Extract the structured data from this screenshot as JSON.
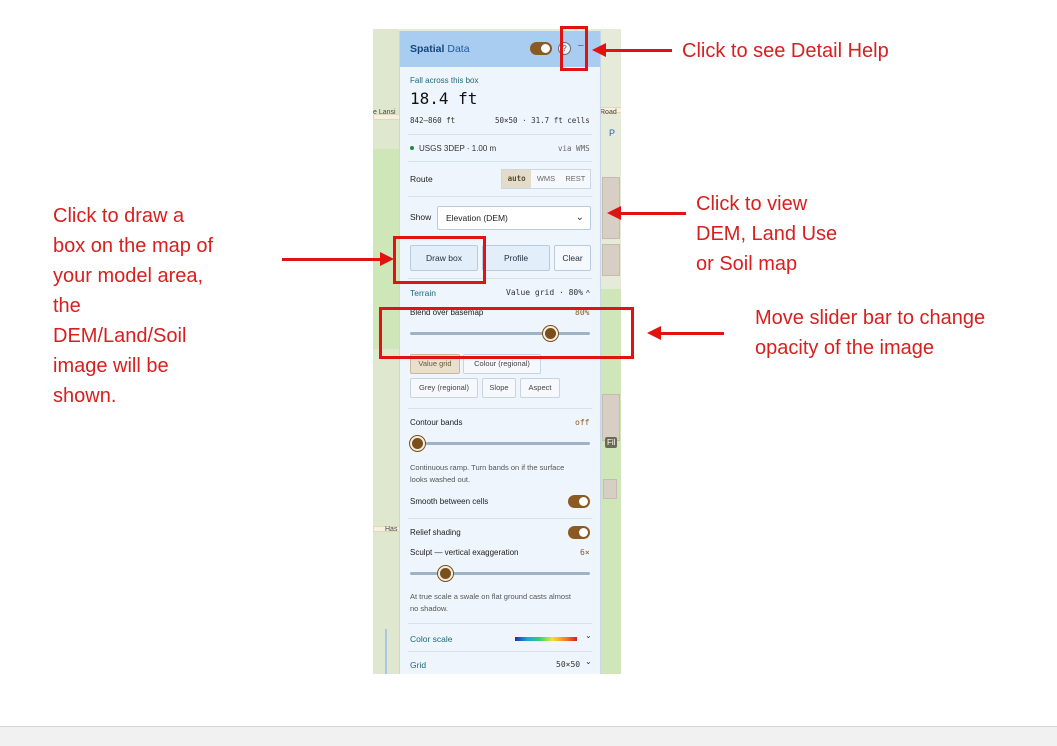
{
  "map": {
    "labels": [
      "e Lansi",
      "Road",
      "Has",
      "P",
      "Fil"
    ]
  },
  "panel": {
    "title_bold": "Spatial",
    "title_rest": "Data",
    "help_glyph": "?",
    "minimize_glyph": "–",
    "fall_label": "Fall across this box",
    "fall_value": "18.4 ft",
    "range": "842–860 ft",
    "grid_info": "50×50 · 31.7 ft cells",
    "source": "USGS 3DEP · 1.00 m",
    "via": "via WMS",
    "route_label": "Route",
    "route_options": [
      "auto",
      "WMS",
      "REST"
    ],
    "show_label": "Show",
    "show_selected": "Elevation (DEM)",
    "buttons": {
      "draw": "Draw box",
      "profile": "Profile",
      "clear": "Clear"
    },
    "terrain_label": "Terrain",
    "terrain_summary": "Value grid · 80%",
    "terrain_chevron": "^",
    "blend_label": "Blend over basemap",
    "blend_value": "80%",
    "blend_level": 0.78,
    "render_modes": [
      "Value grid",
      "Colour (regional)",
      "Grey (regional)",
      "Slope",
      "Aspect"
    ],
    "contour_label": "Contour bands",
    "contour_value": "off",
    "contour_note_1": "Continuous ramp. Turn bands on if the surface",
    "contour_note_2": "looks washed out.",
    "smooth_label": "Smooth between cells",
    "relief_label": "Relief shading",
    "sculpt_label": "Sculpt — vertical exaggeration",
    "sculpt_value": "6×",
    "shadow_note_1": "At true scale a swale on flat ground casts almost",
    "shadow_note_2": "no shadow.",
    "color_scale_label": "Color scale",
    "grid_label": "Grid",
    "grid_value": "50×50",
    "chevron": "⌄"
  },
  "annotations": {
    "help": "Click to see Detail Help",
    "draw": [
      "Click to draw a",
      "box on the map of",
      "your model area,",
      "the",
      "DEM/Land/Soil",
      "image will be",
      "shown."
    ],
    "view": [
      "Click to view",
      "DEM, Land Use",
      "or Soil map"
    ],
    "slider": [
      "Move slider bar to change",
      "opacity of the image"
    ]
  },
  "colors": {
    "accent": "#8a5a22",
    "annotation": "#e01212",
    "header": "#a9cdf0"
  }
}
